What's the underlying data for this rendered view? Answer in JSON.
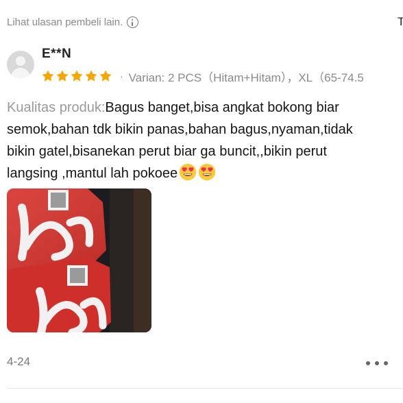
{
  "header": {
    "hint_text": "Lihat ulasan pembeli lain.",
    "hint_icon": "info-icon",
    "right_cut_text": "T"
  },
  "review": {
    "user": "E**N",
    "avatar_icon": "user-avatar-icon",
    "rating": 5,
    "rating_max": 5,
    "star_color": "#F7A600",
    "separator": "·",
    "variant": "Varian: 2 PCS（Hitam+Hitam），XL（65-74.5",
    "quality_label": "Kualitas produk:",
    "lines": [
      "Bagus banget,bisa angkat bokong biar",
      "semok,bahan tdk bikin panas,bahan bagus,nyaman,tidak",
      "bikin gatel,bisanekan perut biar ga buncit,,bikin perut",
      "langsing ,mantul lah pokoee"
    ],
    "emoji_names": [
      "heart-eyes-emoji-icon",
      "heart-eyes-emoji-icon"
    ],
    "photo": "product-photo-red-packages",
    "date": "4-24",
    "more_icon": "more-options-icon"
  }
}
